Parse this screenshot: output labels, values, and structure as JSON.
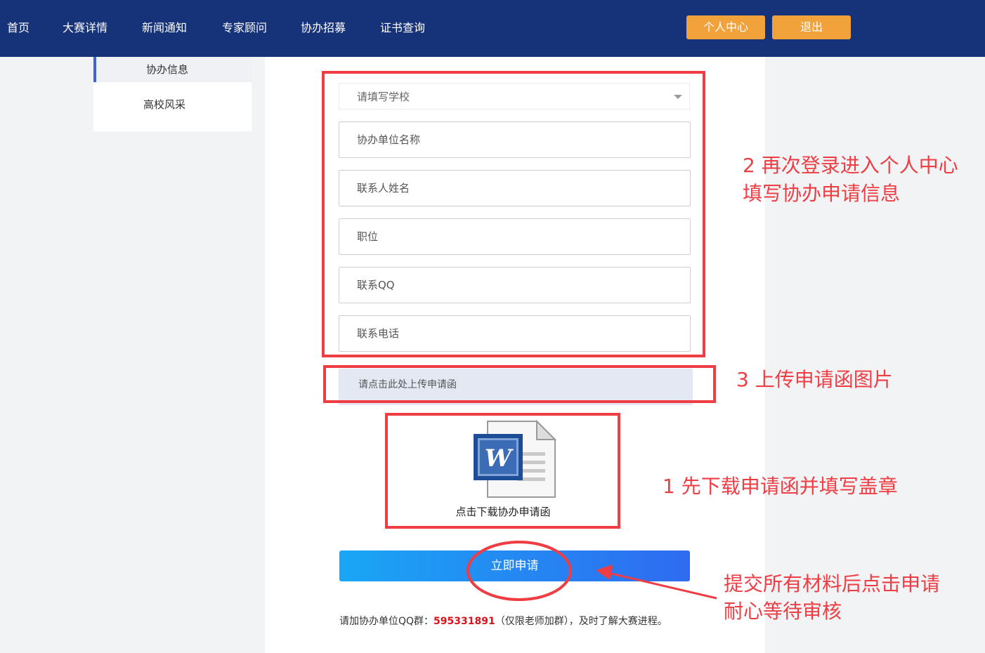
{
  "nav": {
    "items": [
      "首页",
      "大赛详情",
      "新闻通知",
      "专家顾问",
      "协办招募",
      "证书查询"
    ],
    "personal_center": "个人中心",
    "logout": "退出"
  },
  "sidebar": {
    "items": [
      {
        "label": "协办信息",
        "active": true
      },
      {
        "label": "高校风采",
        "active": false
      }
    ]
  },
  "form": {
    "school_placeholder": "请填写学校",
    "org_name_placeholder": "协办单位名称",
    "contact_name_placeholder": "联系人姓名",
    "position_placeholder": "职位",
    "qq_placeholder": "联系QQ",
    "phone_placeholder": "联系电话",
    "upload_label": "请点击此处上传申请函",
    "download_caption": "点击下载协办申请函",
    "submit_label": "立即申请",
    "note_prefix": "请加协办单位QQ群：",
    "qq_group": "595331891",
    "note_suffix": "（仅限老师加群），及时了解大赛进程。"
  },
  "annotations": {
    "step2_line1": "2 再次登录进入个人中心",
    "step2_line2": "填写协办申请信息",
    "step3": "3 上传申请函图片",
    "step1": "1 先下载申请函并填写盖章",
    "step4_line1": "提交所有材料后点击申请",
    "step4_line2": "耐心等待审核"
  },
  "colors": {
    "nav_bg": "#163278",
    "accent_orange": "#f2a23a",
    "annotation_red": "#ef3d44",
    "qq_red": "#d9131c"
  },
  "icons": {
    "word_document": "word-document-icon"
  }
}
